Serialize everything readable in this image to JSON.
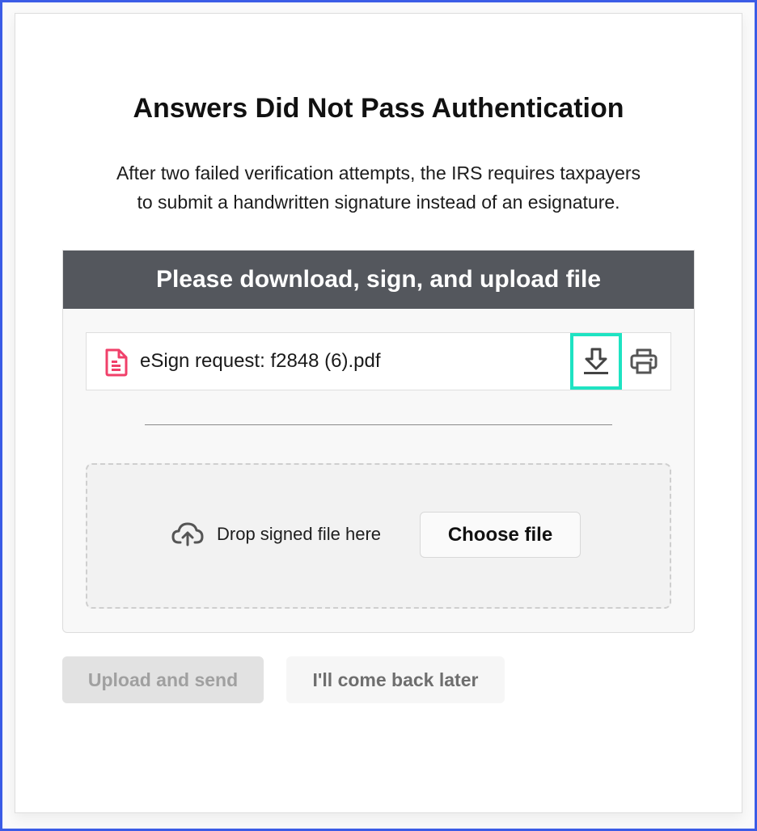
{
  "page": {
    "title": "Answers Did Not Pass Authentication",
    "description_line1": "After two failed verification attempts, the IRS requires taxpayers",
    "description_line2": "to submit a handwritten signature instead of an esignature."
  },
  "panel": {
    "header": "Please download, sign, and upload file",
    "file": {
      "name": "eSign request: f2848 (6).pdf",
      "icon": "pdf-file-icon",
      "download_icon": "download-icon",
      "print_icon": "printer-icon"
    },
    "dropzone": {
      "icon": "cloud-upload-icon",
      "text": "Drop signed file here",
      "choose_label": "Choose file"
    }
  },
  "actions": {
    "upload_label": "Upload and send",
    "later_label": "I'll come back later"
  },
  "colors": {
    "frame_border": "#3b5ce6",
    "panel_header_bg": "#54575d",
    "highlight": "#1ee3c2",
    "file_icon": "#f0406a"
  }
}
